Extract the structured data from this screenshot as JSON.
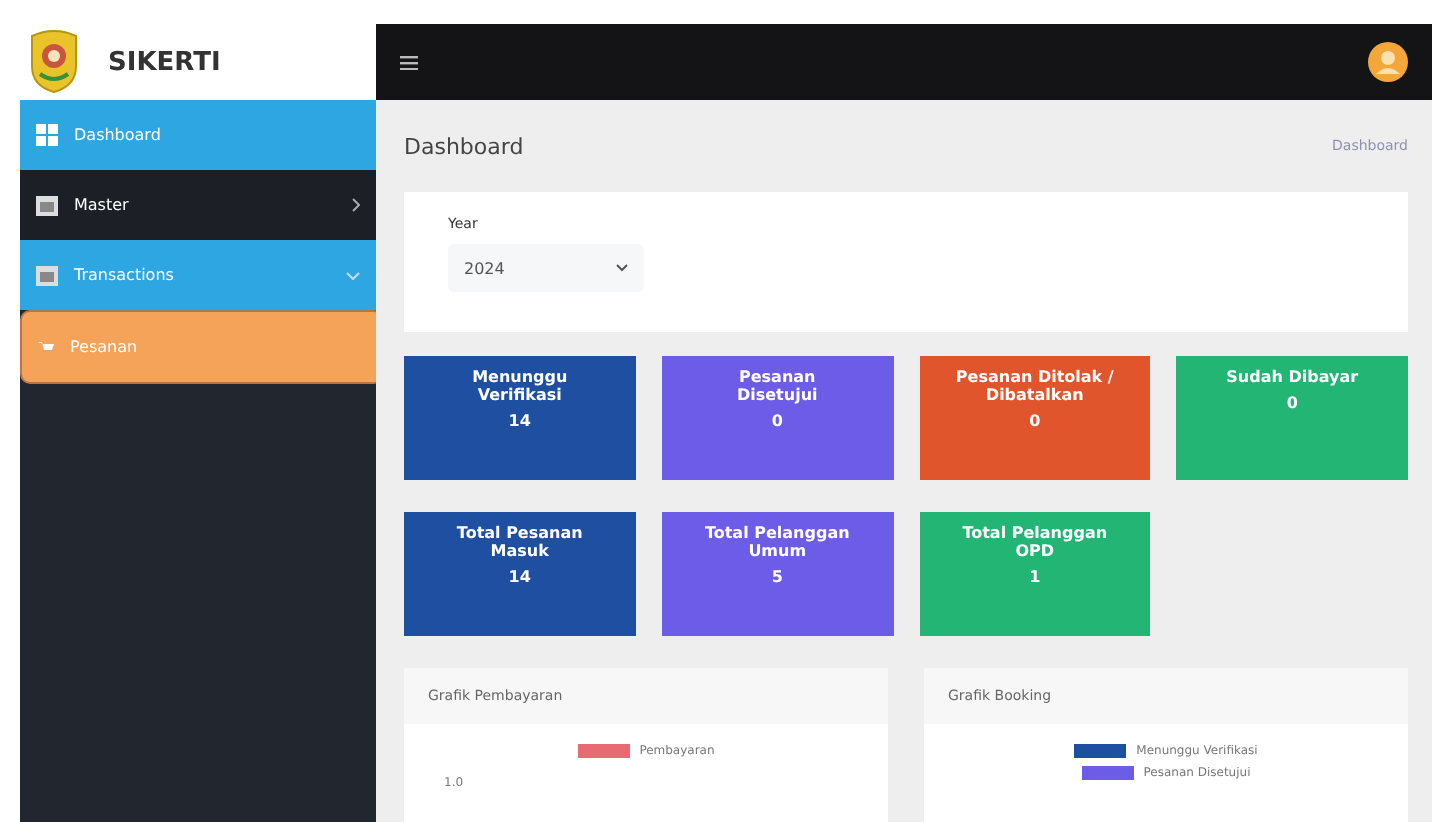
{
  "brand": {
    "name": "SIKERTI"
  },
  "sidebar": {
    "items": [
      {
        "label": "Dashboard",
        "selected": true
      },
      {
        "label": "Master",
        "selected": false,
        "expanded": false
      },
      {
        "label": "Transactions",
        "selected": true,
        "expanded": true,
        "children": [
          {
            "label": "Pesanan",
            "selected": true
          }
        ]
      }
    ]
  },
  "page": {
    "title": "Dashboard",
    "breadcrumb": "Dashboard"
  },
  "filter": {
    "label": "Year",
    "value": "2024"
  },
  "stats": [
    {
      "label": "Menunggu Verifikasi",
      "value": "14",
      "color": "#1f4fa0"
    },
    {
      "label": "Pesanan Disetujui",
      "value": "0",
      "color": "#6c5ce7"
    },
    {
      "label": "Pesanan Ditolak / Dibatalkan",
      "value": "0",
      "color": "#e0552b"
    },
    {
      "label": "Sudah Dibayar",
      "value": "0",
      "color": "#22b573"
    },
    {
      "label": "Total Pesanan Masuk",
      "value": "14",
      "color": "#1f4fa0"
    },
    {
      "label": "Total Pelanggan Umum",
      "value": "5",
      "color": "#6c5ce7"
    },
    {
      "label": "Total Pelanggan OPD",
      "value": "1",
      "color": "#22b573"
    }
  ],
  "charts": [
    {
      "title": "Grafik Pembayaran",
      "tick": "1.0",
      "legend": [
        {
          "label": "Pembayaran",
          "color": "#e86a72"
        }
      ]
    },
    {
      "title": "Grafik Booking",
      "legend": [
        {
          "label": "Menunggu Verifikasi",
          "color": "#1f4fa0"
        },
        {
          "label": "Pesanan Disetujui",
          "color": "#6c5ce7"
        }
      ]
    }
  ]
}
